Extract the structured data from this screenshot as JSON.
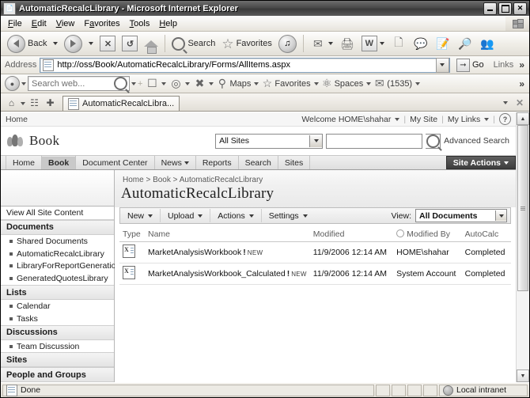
{
  "window": {
    "title": "AutomaticRecalcLibrary - Microsoft Internet Explorer",
    "icon": "page-icon",
    "minimize": "Minimize",
    "maximize": "Maximize",
    "close": "Close"
  },
  "menubar": {
    "items": [
      {
        "label": "File",
        "accel": "F"
      },
      {
        "label": "Edit",
        "accel": "E"
      },
      {
        "label": "View",
        "accel": "V"
      },
      {
        "label": "Favorites",
        "accel": "a"
      },
      {
        "label": "Tools",
        "accel": "T"
      },
      {
        "label": "Help",
        "accel": "H"
      }
    ]
  },
  "ie_toolbar": {
    "back": "Back",
    "search": "Search",
    "favorites": "Favorites",
    "icons": [
      "stop-icon",
      "refresh-icon",
      "home-icon",
      "media-icon",
      "mail-icon",
      "print-icon",
      "edit-word-icon",
      "blank-page-icon",
      "messenger-icon",
      "discuss-icon",
      "research-icon",
      "people-icon"
    ]
  },
  "address_bar": {
    "label": "Address",
    "url": "http://oss/Book/AutomaticRecalcLibrary/Forms/AllItems.aspx",
    "go": "Go",
    "links": "Links",
    "overflow": "»"
  },
  "live_toolbar": {
    "search_placeholder": "Search web...",
    "items": [
      {
        "label": "Maps",
        "icon": "maps-icon"
      },
      {
        "label": "Favorites",
        "icon": "star-icon"
      },
      {
        "label": "Spaces",
        "icon": "spaces-icon"
      },
      {
        "label": "(1535)",
        "icon": "mail-icon"
      }
    ],
    "overflow": "»"
  },
  "tab_bar": {
    "tabs": [
      {
        "label": "AutomaticRecalcLibra...",
        "icon": "page-icon"
      }
    ],
    "quick_tabs_icon": "quick-tabs-icon",
    "new_tab_icon": "new-tab-icon",
    "home_icon": "home-icon",
    "close_tab": "✕"
  },
  "sharepoint": {
    "welcome": {
      "home_link": "Home",
      "user": "Welcome HOME\\shahar",
      "my_site": "My Site",
      "my_links": "My Links",
      "help_icon": "help-icon"
    },
    "site_name": "Book",
    "search": {
      "scope": "All Sites",
      "query": "",
      "advanced": "Advanced Search",
      "go_icon": "search-icon"
    },
    "nav_tabs": [
      {
        "label": "Home",
        "selected": false,
        "has_menu": false
      },
      {
        "label": "Book",
        "selected": true,
        "has_menu": false
      },
      {
        "label": "Document Center",
        "selected": false,
        "has_menu": false
      },
      {
        "label": "News",
        "selected": false,
        "has_menu": true
      },
      {
        "label": "Reports",
        "selected": false,
        "has_menu": false
      },
      {
        "label": "Search",
        "selected": false,
        "has_menu": false
      },
      {
        "label": "Sites",
        "selected": false,
        "has_menu": false
      }
    ],
    "site_actions": "Site Actions",
    "left_nav": {
      "view_all": "View All Site Content",
      "sections": [
        {
          "heading": "Documents",
          "items": [
            "Shared Documents",
            "AutomaticRecalcLibrary",
            "LibraryForReportGeneration",
            "GeneratedQuotesLibrary"
          ]
        },
        {
          "heading": "Lists",
          "items": [
            "Calendar",
            "Tasks"
          ]
        },
        {
          "heading": "Discussions",
          "items": [
            "Team Discussion"
          ]
        },
        {
          "heading": "Sites",
          "items": []
        },
        {
          "heading": "People and Groups",
          "items": []
        }
      ]
    },
    "breadcrumb": "Home > Book > AutomaticRecalcLibrary",
    "page_title": "AutomaticRecalcLibrary",
    "library_icon": "document-library-icon",
    "library_toolbar": {
      "buttons": [
        "New",
        "Upload",
        "Actions",
        "Settings"
      ],
      "view_label": "View:",
      "view_value": "All Documents"
    },
    "table": {
      "columns": [
        "Type",
        "Name",
        "Modified",
        "Modified By",
        "AutoCalc"
      ],
      "rows": [
        {
          "type_icon": "excel-workbook-icon",
          "name": "MarketAnalysisWorkbook",
          "alert": "!",
          "badge": "NEW",
          "modified": "11/9/2006 12:14 AM",
          "modified_by": "HOME\\shahar",
          "autocalc": "Completed"
        },
        {
          "type_icon": "excel-workbook-icon",
          "name": "MarketAnalysisWorkbook_Calculated",
          "alert": "!",
          "badge": "NEW",
          "modified": "11/9/2006 12:14 AM",
          "modified_by": "System Account",
          "autocalc": "Completed"
        }
      ]
    }
  },
  "status_bar": {
    "message": "Done",
    "zone": "Local intranet",
    "zone_icon": "globe-icon",
    "page_icon": "page-icon"
  }
}
